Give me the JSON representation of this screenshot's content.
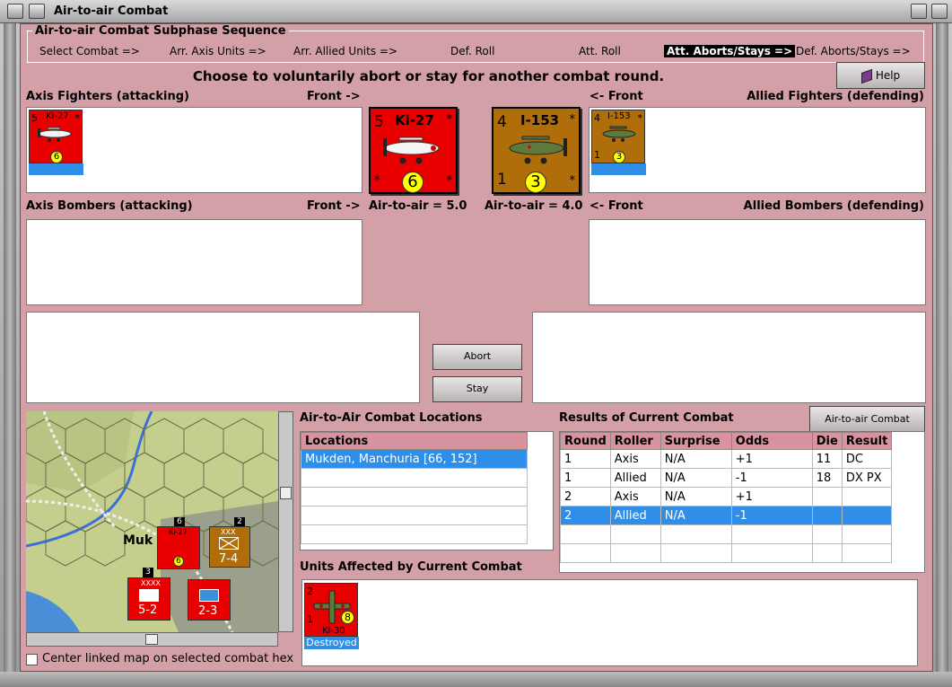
{
  "window": {
    "title": "Air-to-air Combat"
  },
  "sequence": {
    "title": "Air-to-air Combat Subphase Sequence",
    "steps": [
      {
        "label": "Select Combat =>",
        "active": false
      },
      {
        "label": "Arr. Axis Units =>",
        "active": false
      },
      {
        "label": "Arr. Allied Units =>",
        "active": false
      },
      {
        "label": "Def. Roll",
        "active": false
      },
      {
        "label": "Att. Roll",
        "active": false
      },
      {
        "label": "Att. Aborts/Stays =>",
        "active": true
      },
      {
        "label": "Def. Aborts/Stays =>",
        "active": false
      }
    ]
  },
  "instruction": "Choose to voluntarily abort or stay for another combat round.",
  "help_label": "Help",
  "axis_fighters": {
    "heading": "Axis Fighters (attacking)",
    "front": "Front ->"
  },
  "allied_fighters": {
    "heading": "Allied Fighters (defending)",
    "front": "<- Front"
  },
  "axis_bombers": {
    "heading": "Axis Bombers (attacking)",
    "front": "Front ->"
  },
  "allied_bombers": {
    "heading": "Allied Bombers (defending)",
    "front": "<- Front"
  },
  "axis_unit": {
    "name": "Ki-27",
    "top_left": "5",
    "bottom": "6",
    "star": "*",
    "air_to_air": "Air-to-air = 5.0"
  },
  "allied_unit": {
    "name": "I-153",
    "top_left": "4",
    "bottom_left": "1",
    "bottom": "3",
    "star": "*",
    "air_to_air": "Air-to-air = 4.0"
  },
  "buttons": {
    "abort": "Abort",
    "stay": "Stay",
    "chart": "Air-to-air Combat Chart"
  },
  "locations": {
    "heading": "Air-to-Air Combat Locations",
    "column": "Locations",
    "rows": [
      "Mukden, Manchuria [66, 152]",
      "",
      "",
      "",
      "",
      ""
    ]
  },
  "results": {
    "heading": "Results of Current Combat",
    "columns": [
      "Round",
      "Roller",
      "Surprise",
      "Odds",
      "Die",
      "Result"
    ],
    "rows": [
      [
        "1",
        "Axis",
        "N/A",
        "+1",
        "11",
        "DC"
      ],
      [
        "1",
        "Allied",
        "N/A",
        "-1",
        "18",
        "DX PX"
      ],
      [
        "2",
        "Axis",
        "N/A",
        "+1",
        "",
        ""
      ],
      [
        "2",
        "Allied",
        "N/A",
        "-1",
        "",
        ""
      ],
      [
        "",
        "",
        "",
        "",
        "",
        ""
      ],
      [
        "",
        "",
        "",
        "",
        "",
        ""
      ]
    ],
    "selected_row": 3
  },
  "affected": {
    "heading": "Units Affected by Current Combat",
    "unit": {
      "name": "Ki-30",
      "top_left": "2",
      "bottom_left": "1",
      "bottom": "8",
      "status": "Destroyed"
    }
  },
  "map": {
    "city": "Muk",
    "stack_numbers": [
      "6",
      "2",
      "3"
    ],
    "counters": [
      {
        "name": "Ki-27",
        "value": "6"
      },
      {
        "name": "XXX",
        "value": "7-4"
      },
      {
        "name": "XXXX",
        "value": "5-2"
      },
      {
        "name": "",
        "value": "2-3"
      }
    ]
  },
  "center_map": {
    "label": "Center linked map on selected combat hex",
    "checked": false
  },
  "colors": {
    "pane": "#d4a0a8",
    "axis_counter": "#e80000",
    "allied_counter": "#b06e0b",
    "selection": "#2f8fe8"
  },
  "icons": [
    "close-icon",
    "help-book-icon",
    "biplane-icon"
  ]
}
